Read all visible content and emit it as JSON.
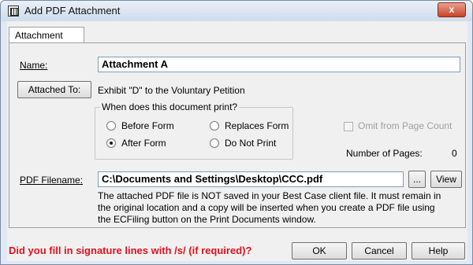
{
  "window": {
    "title": "Add PDF Attachment",
    "close_glyph": "x"
  },
  "tabs": [
    {
      "label": "Attachment"
    }
  ],
  "form": {
    "name_label": "Name:",
    "name_value": "Attachment A",
    "attached_to_button": "Attached To:",
    "attached_to_value": "Exhibit \"D\" to the Voluntary Petition",
    "print_group": {
      "title": "When does this document print?",
      "options": [
        {
          "label": "Before Form",
          "checked": false
        },
        {
          "label": "Replaces Form",
          "checked": false
        },
        {
          "label": "After Form",
          "checked": true
        },
        {
          "label": "Do Not Print",
          "checked": false
        }
      ]
    },
    "omit_checkbox_label": "Omit from Page Count",
    "pages_label": "Number of Pages:",
    "pages_value": "0",
    "pdf_label": "PDF Filename:",
    "pdf_value": "C:\\Documents and Settings\\Desktop\\CCC.pdf",
    "browse_button": "...",
    "view_button": "View",
    "info_lines": [
      "The attached PDF file is NOT saved in your Best Case client file. It must remain in",
      "the original location and a copy will be inserted when you create a PDF file using",
      "the ECFiling button on the Print Documents window."
    ]
  },
  "footer": {
    "warning": "Did you fill in signature lines with /s/ (if required)?",
    "ok_button": "OK",
    "cancel_button": "Cancel",
    "help_button": "Help",
    "warning_color": "#e0121b"
  }
}
